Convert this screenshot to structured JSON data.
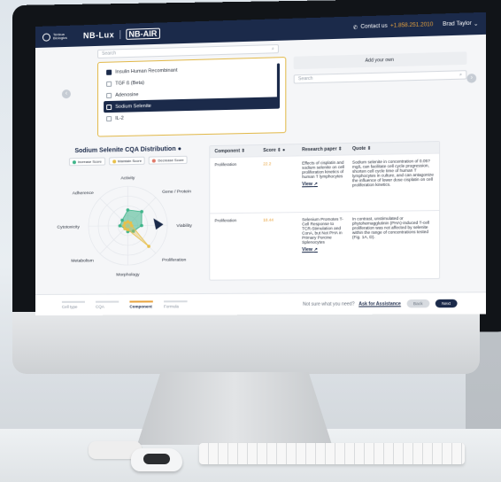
{
  "header": {
    "brand_line1": "Tenkua",
    "brand_line2": "Biologics",
    "product_lux": "NB-Lux",
    "product_air": "NB-AIR",
    "contact_label": "Contact us",
    "contact_phone": "+1.858.251.2010",
    "user_name": "Brad Taylor"
  },
  "search": {
    "placeholder": "Search"
  },
  "component_list": {
    "items": [
      {
        "label": "Insulin Human Recombinant",
        "checked": true,
        "selected": false
      },
      {
        "label": "TGF ß (Beta)",
        "checked": false,
        "selected": false
      },
      {
        "label": "Adenosine",
        "checked": false,
        "selected": false
      },
      {
        "label": "Sodium Selenite",
        "checked": false,
        "selected": true
      },
      {
        "label": "IL-2",
        "checked": false,
        "selected": false
      }
    ]
  },
  "add_own": {
    "title": "Add your own",
    "placeholder": "Search"
  },
  "chart": {
    "title": "Sodium Selenite CQA Distribution",
    "legend": [
      {
        "label": "Increase Score",
        "color": "#3fb58a"
      },
      {
        "label": "Maintain Score",
        "color": "#e8c04a"
      },
      {
        "label": "Decrease Score",
        "color": "#e07a6a"
      }
    ],
    "axes": [
      "Activity",
      "Gene / Protein",
      "Viability",
      "Proliferation",
      "Morphology",
      "Metabolism",
      "Cytotoxicity",
      "Adherence"
    ]
  },
  "chart_data": {
    "type": "radar",
    "title": "Sodium Selenite CQA Distribution",
    "categories": [
      "Activity",
      "Gene / Protein",
      "Viability",
      "Proliferation",
      "Morphology",
      "Metabolism",
      "Cytotoxicity",
      "Adherence"
    ],
    "series": [
      {
        "name": "Increase Score",
        "values": [
          0.4,
          0.5,
          0.35,
          0.2,
          0.15,
          0.1,
          0.2,
          0.2
        ]
      },
      {
        "name": "Maintain Score",
        "values": [
          0.1,
          0.1,
          0.1,
          0.75,
          0.1,
          0.1,
          0.1,
          0.1
        ]
      }
    ]
  },
  "table": {
    "headers": [
      "Component",
      "Score",
      "Research paper",
      "Quote"
    ],
    "rows": [
      {
        "component": "Proliferation",
        "score": "22.2",
        "paper": "Effects of cisplatin and sodium selenite on cell proliferation kinetics of human T lymphocytes",
        "view": "View",
        "quote": "Sodium selenite in concentration of 0.05?mg/L can facilitate cell cycle progression, shorten cell cycle time of human T lymphocytes in culture, and can antagonize the influence of lower dose cisplatin on cell proliferation kinetics."
      },
      {
        "component": "Proliferation",
        "score": "18.44",
        "paper": "Selenium Promotes T-Cell Response to TCR-Stimulation and ConA, but Not PHA in Primary Porcine Splenocytes",
        "view": "View",
        "quote": "In contrast, unstimulated or phytohemagglutinin (PHA)-induced T-cell proliferation was not affected by selenite within the range of concentrations tested (Fig. 1A, D)."
      }
    ]
  },
  "steps": [
    {
      "label": "Cell type",
      "active": false
    },
    {
      "label": "CQA",
      "active": false
    },
    {
      "label": "Component",
      "active": true
    },
    {
      "label": "Formula",
      "active": false
    }
  ],
  "footer": {
    "help_text": "Not sure what you need?",
    "help_link": "Ask for Assistance",
    "back_label": "Back",
    "next_label": "Next"
  }
}
